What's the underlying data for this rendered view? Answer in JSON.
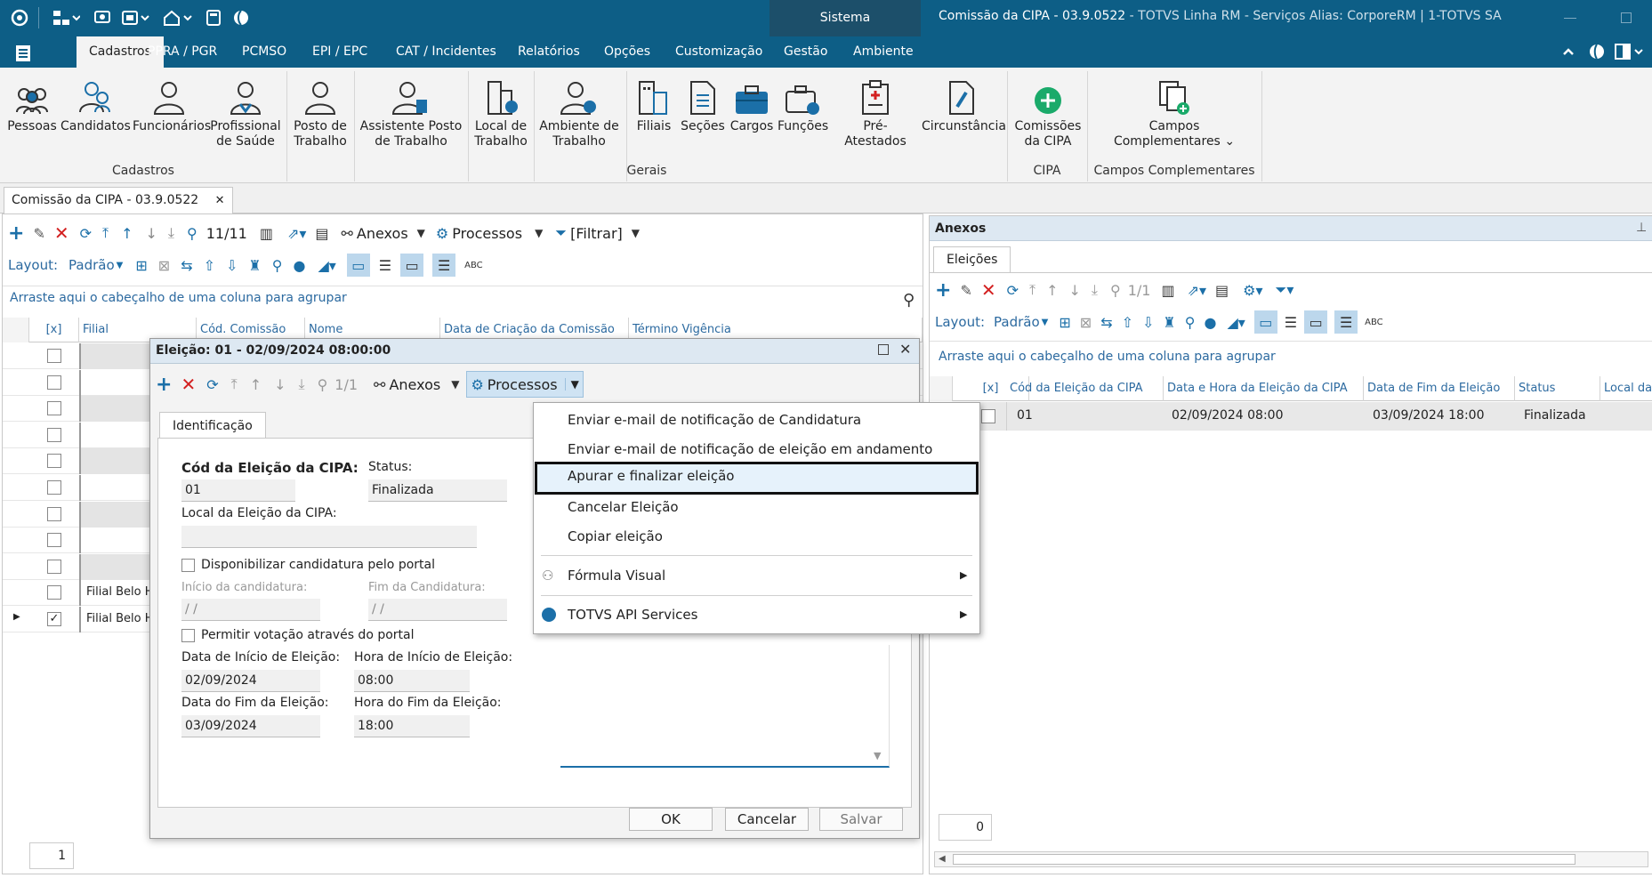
{
  "window": {
    "center_title": "Sistema",
    "title_main": "Comissão da CIPA - 03.9.0522",
    "title_rest": " - TOTVS Linha RM - Serviços  Alias: CorporeRM | 1-TOTVS SA"
  },
  "menu": {
    "tabs": [
      "Cadastros",
      "PPRA / PGR",
      "PCMSO",
      "EPI / EPC",
      "CAT / Incidentes",
      "Relatórios",
      "Opções",
      "Customização",
      "Gestão",
      "Ambiente"
    ]
  },
  "ribbon": {
    "pessoas": "Pessoas",
    "candidatos": "Candidatos",
    "funcionarios": "Funcionários",
    "profissional_l1": "Profissional",
    "profissional_l2": "de Saúde",
    "posto_l1": "Posto de",
    "posto_l2": "Trabalho",
    "assistente_l1": "Assistente Posto",
    "assistente_l2": "de Trabalho",
    "local_l1": "Local de",
    "local_l2": "Trabalho",
    "ambiente_l1": "Ambiente de",
    "ambiente_l2": "Trabalho",
    "filiais": "Filiais",
    "secoes": "Seções",
    "cargos": "Cargos",
    "funcoes": "Funções",
    "pre_atestados": "Pré-Atestados",
    "circunstancia": "Circunstância",
    "comissoes_l1": "Comissões",
    "comissoes_l2": "da CIPA",
    "campos_l1": "Campos",
    "campos_l2": "Complementares",
    "group_cadastros": "Cadastros",
    "group_gerais": "Gerais",
    "group_cipa": "CIPA",
    "group_campos": "Campos Complementares"
  },
  "doc_tab": "Comissão da CIPA - 03.9.0522",
  "main": {
    "record_counter": "11/11",
    "anexos": "Anexos",
    "processos": "Processos",
    "filtrar": "[Filtrar]",
    "layout_label": "Layout:",
    "layout_value": "Padrão",
    "group_hint": "Arraste aqui o cabeçalho de uma coluna para agrupar",
    "columns": [
      "[x]",
      "Filial",
      "Cód. Comissão",
      "Nome",
      "Data de Criação da Comissão",
      "Término Vigência"
    ],
    "filial_values": [
      "Filial Belo H",
      "Filial Belo H"
    ],
    "page_number": "1"
  },
  "anexos_panel": {
    "title": "Anexos",
    "tab": "Eleições",
    "counter": "1/1",
    "layout_label": "Layout:",
    "layout_value": "Padrão",
    "group_hint": "Arraste aqui o cabeçalho de uma coluna para agrupar",
    "columns": [
      "[x]",
      "Cód da Eleição da CIPA",
      "Data e Hora da Eleição da CIPA",
      "Data de Fim da Eleição",
      "Status",
      "Local da"
    ],
    "row": {
      "cod": "01",
      "data_hora": "02/09/2024 08:00",
      "fim": "03/09/2024 18:00",
      "status": "Finalizada"
    },
    "footer_count": "0"
  },
  "dialog": {
    "title": "Eleição: 01 - 02/09/2024 08:00:00",
    "counter": "1/1",
    "anexos": "Anexos",
    "processos": "Processos",
    "tab": "Identificação",
    "cod_label": "Cód da Eleição da CIPA:",
    "cod_value": "01",
    "status_label": "Status:",
    "status_value": "Finalizada",
    "local_label": "Local da Eleição da CIPA:",
    "local_value": "",
    "disp_label": "Disponibilizar candidatura pelo portal",
    "inicio_cand_label": "Início da candidatura:",
    "inicio_cand_value": " / /",
    "fim_cand_label": "Fim da Candidatura:",
    "fim_cand_value": " / /",
    "permitir_label": "Permitir votação através do portal",
    "data_inicio_label": "Data de Início de Eleição:",
    "data_inicio_value": "02/09/2024",
    "hora_inicio_label": "Hora de Início de Eleição:",
    "hora_inicio_value": "08:00",
    "data_fim_label": "Data do Fim da Eleição:",
    "data_fim_value": "03/09/2024",
    "hora_fim_label": "Hora do Fim da Eleição:",
    "hora_fim_value": "18:00",
    "ok": "OK",
    "cancelar": "Cancelar",
    "salvar": "Salvar"
  },
  "context_menu": {
    "items": [
      "Enviar e-mail de notificação de Candidatura",
      "Enviar e-mail de notificação de eleição em andamento",
      "Apurar e finalizar eleição",
      "Cancelar Eleição",
      "Copiar eleição",
      "Fórmula Visual",
      "TOTVS API Services"
    ]
  },
  "colors": {
    "titlebar": "#0d5e86",
    "accent": "#1b6fa8",
    "delete": "#d32020",
    "highlight": "#e6f2fb"
  }
}
